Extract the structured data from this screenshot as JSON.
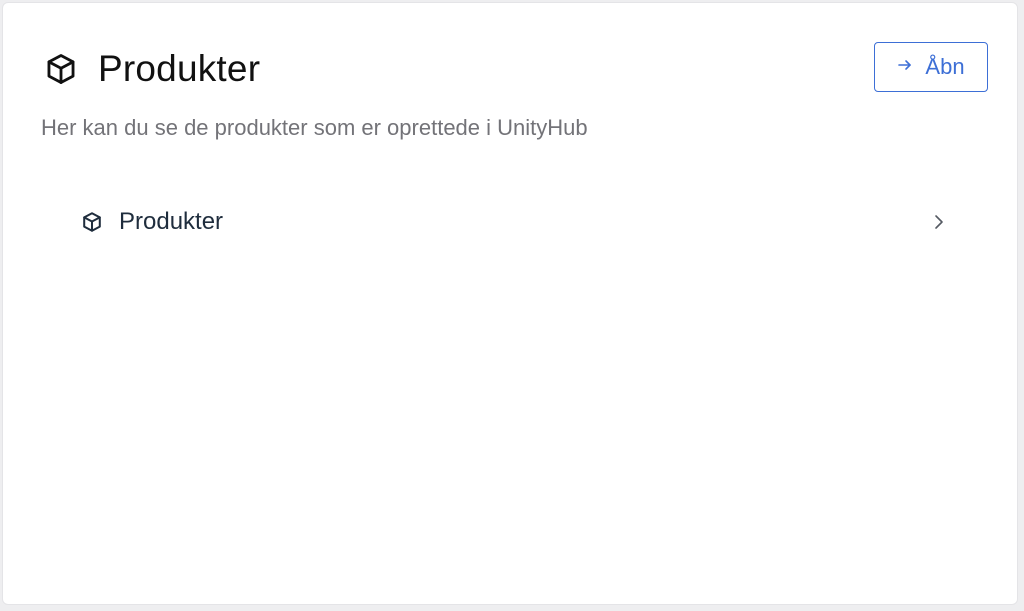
{
  "card": {
    "title": "Produkter",
    "title_icon": "package-icon",
    "subtitle": "Her kan du se de produkter som er oprettede i UnityHub",
    "open_button": {
      "label": "Åbn",
      "icon": "arrow-right-icon",
      "color": "#3d6fd6"
    }
  },
  "list": {
    "items": [
      {
        "label": "Produkter",
        "icon": "package-icon",
        "trailing_icon": "chevron-right-icon"
      }
    ]
  }
}
